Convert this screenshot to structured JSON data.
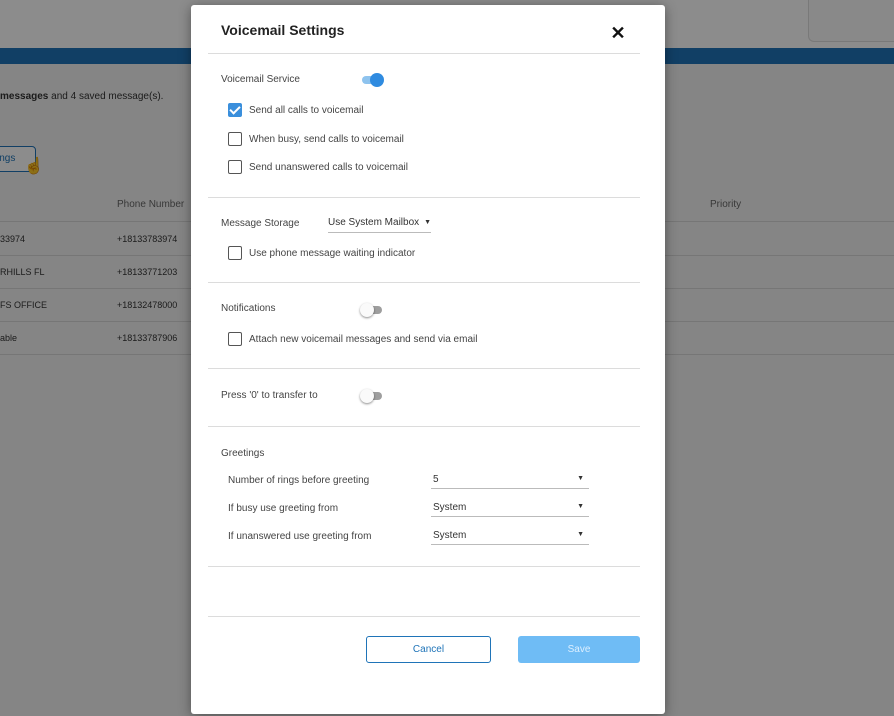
{
  "background": {
    "message_bold": "messages",
    "message_rest": " and 4 saved message(s).",
    "settings_button_fragment": "ings",
    "columns": {
      "phone_number": "Phone Number",
      "priority": "Priority"
    },
    "rows": [
      {
        "name": "33974",
        "phone": "+18133783974"
      },
      {
        "name": "RHILLS FL",
        "phone": "+18133771203"
      },
      {
        "name": "FS OFFICE",
        "phone": "+18132478000"
      },
      {
        "name": "able",
        "phone": "+18133787906"
      }
    ]
  },
  "modal": {
    "title": "Voicemail Settings",
    "close_glyph": "✕",
    "voicemail_service": {
      "label": "Voicemail Service",
      "enabled": true,
      "options": [
        {
          "label": "Send all calls to voicemail",
          "checked": true
        },
        {
          "label": "When busy, send calls to voicemail",
          "checked": false
        },
        {
          "label": "Send unanswered calls to voicemail",
          "checked": false
        }
      ]
    },
    "message_storage": {
      "label": "Message Storage",
      "value": "Use System Mailbox",
      "waiting_indicator": {
        "label": "Use phone message waiting indicator",
        "checked": false
      }
    },
    "notifications": {
      "label": "Notifications",
      "enabled": false,
      "attach": {
        "label": "Attach new voicemail messages and send via email",
        "checked": false
      }
    },
    "transfer": {
      "label": "Press '0' to transfer to",
      "enabled": false
    },
    "greetings": {
      "label": "Greetings",
      "rings": {
        "label": "Number of rings before greeting",
        "value": "5"
      },
      "busy": {
        "label": "If busy use greeting from",
        "value": "System"
      },
      "unanswered": {
        "label": "If unanswered use greeting from",
        "value": "System"
      }
    },
    "buttons": {
      "cancel": "Cancel",
      "save": "Save"
    }
  },
  "colors": {
    "accent": "#1f74b8",
    "checkbox_checked": "#3a8fdc",
    "toggle_on": "#2f8be0",
    "save_disabled": "#6fbcf5"
  },
  "icons": {
    "close": "close-icon",
    "caret": "chevron-down-icon",
    "check": "check-icon",
    "cursor": "hand-pointer-icon"
  }
}
